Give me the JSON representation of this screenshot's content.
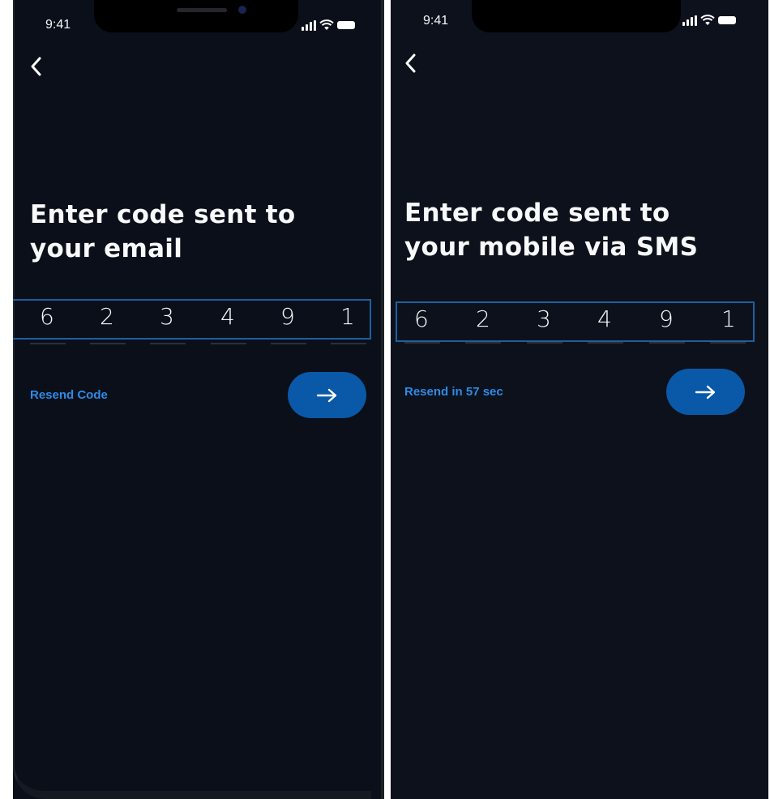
{
  "colors": {
    "background": "#0c101b",
    "accent": "#0a58a8",
    "link": "#2d8ae6",
    "input_border": "#1d5f9f"
  },
  "screens": [
    {
      "status_time": "9:41",
      "title_line1": "Enter code sent to",
      "title_line2": "your email",
      "code_digits": [
        "6",
        "2",
        "3",
        "4",
        "9",
        "1"
      ],
      "resend_label": "Resend Code",
      "icons": {
        "back": "chevron-left-icon",
        "next": "arrow-right-icon"
      }
    },
    {
      "status_time": "9:41",
      "title_line1": "Enter code sent to",
      "title_line2": "your mobile via SMS",
      "code_digits": [
        "6",
        "2",
        "3",
        "4",
        "9",
        "1"
      ],
      "resend_label": "Resend in 57 sec",
      "icons": {
        "back": "chevron-left-icon",
        "next": "arrow-right-icon"
      }
    }
  ]
}
